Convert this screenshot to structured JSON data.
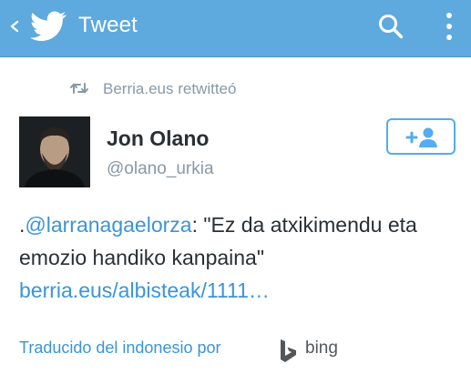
{
  "header": {
    "title": "Tweet",
    "background_color": "#5ea9dd",
    "icons": [
      "back-icon",
      "twitter-bird-icon",
      "search-icon",
      "overflow-menu-icon"
    ]
  },
  "retweet": {
    "text": "Berria.eus retwitteó",
    "icon": "retweet-icon"
  },
  "author": {
    "name": "Jon Olano",
    "handle": "@olano_urkia",
    "follow_icon": "add-user-icon"
  },
  "tweet": {
    "prefix": ".",
    "mention": "@larranagaelorza",
    "body": ": \"Ez da atxikimendu eta emozio handiko kanpaina\" ",
    "link": "berria.eus/albisteak/1111…"
  },
  "translation": {
    "text": "Traducido del indonesio por",
    "provider": "bing",
    "icon": "bing-logo-icon"
  },
  "colors": {
    "accent": "#55acee",
    "link": "#3b94d9",
    "muted": "#8899a6",
    "text": "#292f33"
  }
}
